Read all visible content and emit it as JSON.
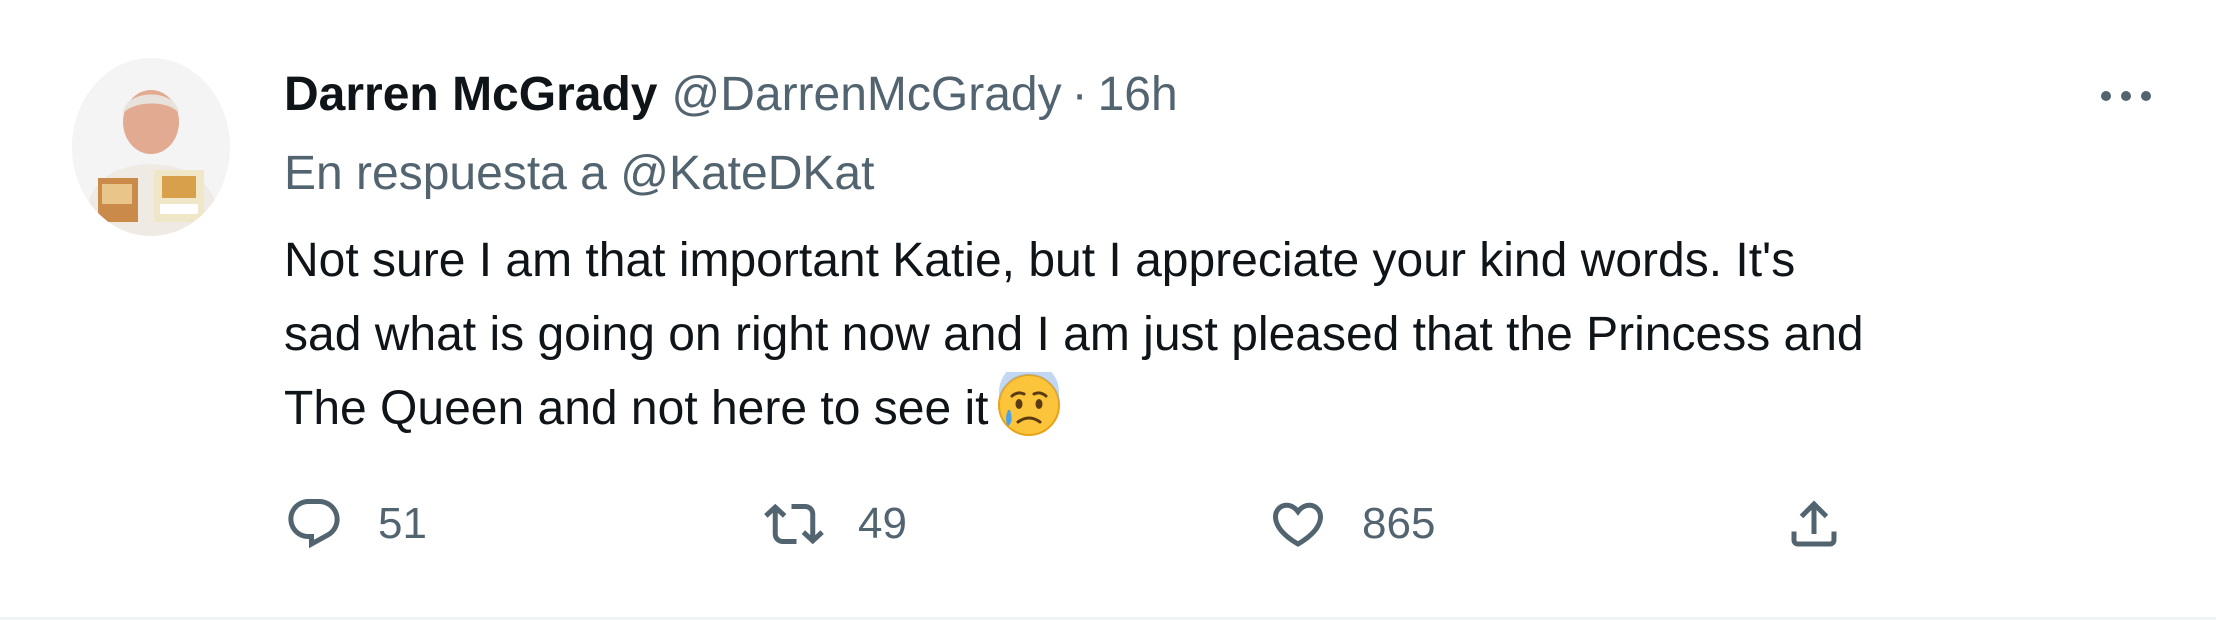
{
  "tweet": {
    "author": {
      "display_name": "Darren McGrady",
      "handle": "@DarrenMcGrady",
      "avatar_icon": "avatar-photo"
    },
    "separator": "·",
    "time": "16h",
    "reply_prefix": "En respuesta a",
    "reply_to": "@KateDKat",
    "text_lines": [
      "Not sure I am that important Katie, but I appreciate your kind words. It's",
      "sad what is going on right now and I am just pleased that the Princess and",
      "The Queen and not here to see it"
    ],
    "emoji": "sad-but-relieved-face",
    "actions": {
      "reply": {
        "icon": "reply-icon",
        "count": "51"
      },
      "retweet": {
        "icon": "retweet-icon",
        "count": "49"
      },
      "like": {
        "icon": "heart-icon",
        "count": "865"
      },
      "share": {
        "icon": "share-icon"
      }
    },
    "more_icon": "more-icon"
  },
  "colors": {
    "text_primary": "#0f1419",
    "text_secondary": "#536471",
    "border": "#eff3f4",
    "background": "#ffffff"
  }
}
